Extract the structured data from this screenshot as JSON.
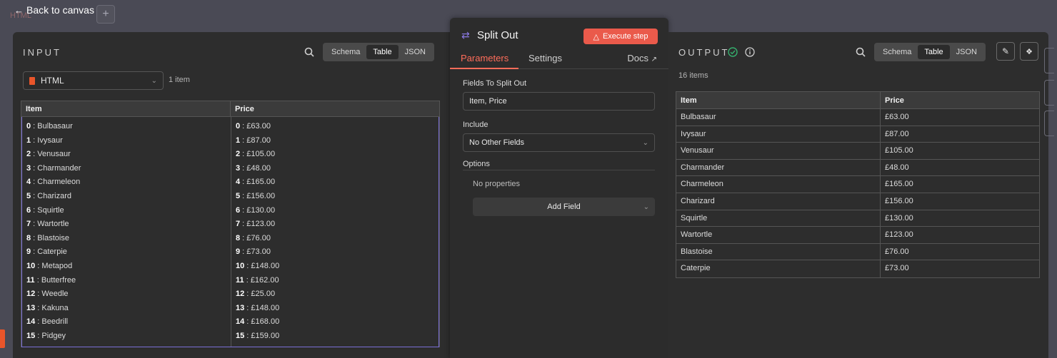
{
  "topbar": {
    "back_label": "Back to canvas",
    "back_icon": "arrow-left-icon",
    "ghost_text": "HTML",
    "add_icon": "plus-icon"
  },
  "input_panel": {
    "title": "INPUT",
    "view_options": [
      "Schema",
      "Table",
      "JSON"
    ],
    "active_view": "Table",
    "node_select": "HTML",
    "item_count": "1 item",
    "columns": [
      "Item",
      "Price"
    ],
    "items": [
      {
        "i": "0",
        "v": "Bulbasaur"
      },
      {
        "i": "1",
        "v": "Ivysaur"
      },
      {
        "i": "2",
        "v": "Venusaur"
      },
      {
        "i": "3",
        "v": "Charmander"
      },
      {
        "i": "4",
        "v": "Charmeleon"
      },
      {
        "i": "5",
        "v": "Charizard"
      },
      {
        "i": "6",
        "v": "Squirtle"
      },
      {
        "i": "7",
        "v": "Wartortle"
      },
      {
        "i": "8",
        "v": "Blastoise"
      },
      {
        "i": "9",
        "v": "Caterpie"
      },
      {
        "i": "10",
        "v": "Metapod"
      },
      {
        "i": "11",
        "v": "Butterfree"
      },
      {
        "i": "12",
        "v": "Weedle"
      },
      {
        "i": "13",
        "v": "Kakuna"
      },
      {
        "i": "14",
        "v": "Beedrill"
      },
      {
        "i": "15",
        "v": "Pidgey"
      }
    ],
    "prices": [
      {
        "i": "0",
        "v": "£63.00"
      },
      {
        "i": "1",
        "v": "£87.00"
      },
      {
        "i": "2",
        "v": "£105.00"
      },
      {
        "i": "3",
        "v": "£48.00"
      },
      {
        "i": "4",
        "v": "£165.00"
      },
      {
        "i": "5",
        "v": "£156.00"
      },
      {
        "i": "6",
        "v": "£130.00"
      },
      {
        "i": "7",
        "v": "£123.00"
      },
      {
        "i": "8",
        "v": "£76.00"
      },
      {
        "i": "9",
        "v": "£73.00"
      },
      {
        "i": "10",
        "v": "£148.00"
      },
      {
        "i": "11",
        "v": "£162.00"
      },
      {
        "i": "12",
        "v": "£25.00"
      },
      {
        "i": "13",
        "v": "£148.00"
      },
      {
        "i": "14",
        "v": "£168.00"
      },
      {
        "i": "15",
        "v": "£159.00"
      }
    ]
  },
  "node_panel": {
    "name": "Split Out",
    "execute_label": "Execute step",
    "tabs": [
      "Parameters",
      "Settings"
    ],
    "active_tab": "Parameters",
    "docs_label": "Docs",
    "fields_label": "Fields To Split Out",
    "fields_value": "Item, Price",
    "include_label": "Include",
    "include_value": "No Other Fields",
    "options_label": "Options",
    "no_properties": "No properties",
    "add_field_label": "Add Field"
  },
  "output_panel": {
    "title": "OUTPUT",
    "status": "success",
    "item_count": "16 items",
    "view_options": [
      "Schema",
      "Table",
      "JSON"
    ],
    "active_view": "Table",
    "columns": [
      "Item",
      "Price"
    ],
    "rows": [
      [
        "Bulbasaur",
        "£63.00"
      ],
      [
        "Ivysaur",
        "£87.00"
      ],
      [
        "Venusaur",
        "£105.00"
      ],
      [
        "Charmander",
        "£48.00"
      ],
      [
        "Charmeleon",
        "£165.00"
      ],
      [
        "Charizard",
        "£156.00"
      ],
      [
        "Squirtle",
        "£130.00"
      ],
      [
        "Wartortle",
        "£123.00"
      ],
      [
        "Blastoise",
        "£76.00"
      ],
      [
        "Caterpie",
        "£73.00"
      ]
    ]
  },
  "colors": {
    "accent": "#ff6d5a",
    "execute": "#ea5a4b",
    "success": "#35b06e",
    "node_icon": "#8c7ae6"
  }
}
